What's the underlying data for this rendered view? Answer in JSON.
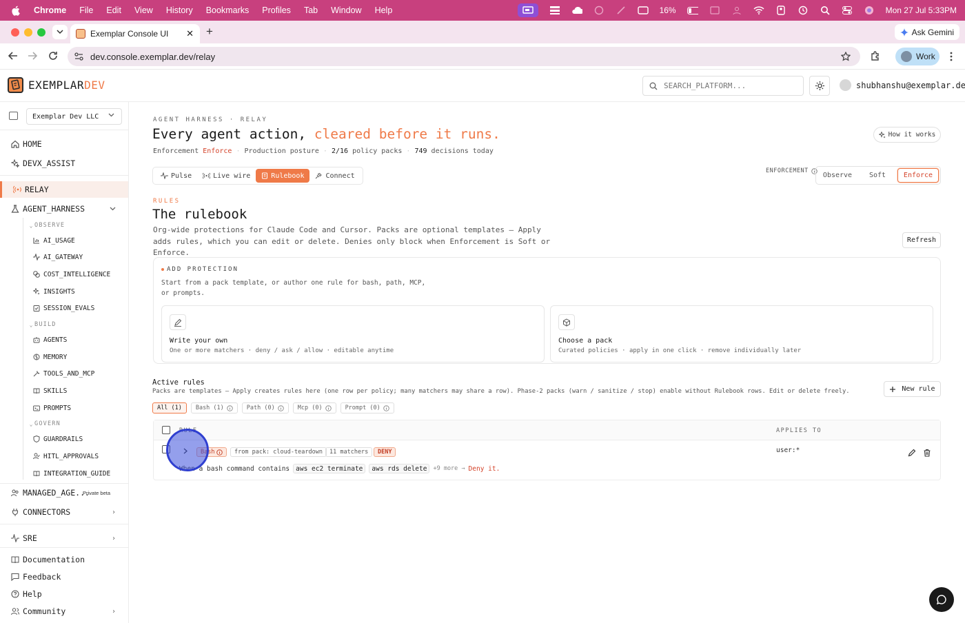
{
  "menubar": {
    "app": "Chrome",
    "items": [
      "File",
      "Edit",
      "View",
      "History",
      "Bookmarks",
      "Profiles",
      "Tab",
      "Window",
      "Help"
    ],
    "battery": "16%",
    "datetime": "Mon 27 Jul  5:33PM"
  },
  "browser": {
    "tab_title": "Exemplar Console UI",
    "url": "dev.console.exemplar.dev/relay",
    "ask_gemini": "Ask Gemini",
    "profile": "Work"
  },
  "app": {
    "brand_main": "EXEMPLAR",
    "brand_accent": "DEV",
    "search_placeholder": "SEARCH_PLATFORM...",
    "user_email": "shubhanshu@exemplar.dev"
  },
  "sidebar": {
    "org": "Exemplar Dev LLC",
    "home": "HOME",
    "devx_assist": "DEVX_ASSIST",
    "relay": "RELAY",
    "agent_harness": "AGENT_HARNESS",
    "group_observe": "OBSERVE",
    "ai_usage": "AI_USAGE",
    "ai_gateway": "AI_GATEWAY",
    "cost_intelligence": "COST_INTELLIGENCE",
    "insights": "INSIGHTS",
    "session_evals": "SESSION_EVALS",
    "group_build": "BUILD",
    "agents": "AGENTS",
    "memory": "MEMORY",
    "tools_and_mcp": "TOOLS_AND_MCP",
    "skills": "SKILLS",
    "prompts": "PROMPTS",
    "group_govern": "GOVERN",
    "guardrails": "GUARDRAILS",
    "hitl_approvals": "HITL_APPROVALS",
    "integration_guide": "INTEGRATION_GUIDE",
    "managed_agents": "MANAGED_AGE...",
    "private_beta": "Private beta",
    "connectors": "CONNECTORS",
    "sre": "SRE",
    "documentation": "Documentation",
    "feedback": "Feedback",
    "help": "Help",
    "community": "Community"
  },
  "page": {
    "eyebrow": "AGENT HARNESS · RELAY",
    "headline_main": "Every agent action,",
    "headline_accent": "cleared before it runs.",
    "meta_enforcement_label": "Enforcement",
    "meta_enforcement_value": "Enforce",
    "meta_posture": "Production posture",
    "meta_packs_value": "2/16",
    "meta_packs_label": "policy packs",
    "meta_decisions_value": "749",
    "meta_decisions_label": "decisions today",
    "how_it_works": "How it works",
    "tabs": {
      "pulse": "Pulse",
      "live_wire": "Live wire",
      "rulebook": "Rulebook",
      "connect": "Connect"
    },
    "enforcement_label": "ENFORCEMENT",
    "enforcement_options": {
      "observe": "Observe",
      "soft": "Soft",
      "enforce": "Enforce"
    }
  },
  "rulebook": {
    "eyebrow": "RULES",
    "title": "The rulebook",
    "description": "Org-wide protections for Claude Code and Cursor. Packs are optional templates — Apply adds rules, which you can edit or delete. Denies only block when Enforcement is Soft or Enforce.",
    "refresh": "Refresh",
    "add_protection": {
      "eyebrow": "ADD PROTECTION",
      "subtitle": "Start from a pack template, or author one rule for bash, path, MCP, or prompts.",
      "write_title": "Write your own",
      "write_desc": "One or more matchers · deny / ask / allow · editable anytime",
      "pack_title": "Choose a pack",
      "pack_desc": "Curated policies · apply in one click · remove individually later"
    },
    "active_rules": {
      "title": "Active rules",
      "description": "Packs are templates — Apply creates rules here (one row per policy; many matchers may share a row). Phase-2 packs (warn / sanitize / stop) enable without Rulebook rows. Edit or delete freely.",
      "new_rule": "New rule",
      "filters": {
        "all": "All (1)",
        "bash": "Bash (1)",
        "path": "Path (0)",
        "mcp": "Mcp (0)",
        "prompt": "Prompt (0)"
      },
      "col_rule": "RULE",
      "col_applies": "APPLIES TO",
      "row": {
        "type": "Bash",
        "pack": "from pack: cloud-teardown",
        "matchers": "11 matchers",
        "action": "DENY",
        "when_prefix": "When a bash command contains",
        "cmd1": "aws ec2 terminate",
        "cmd2": "aws rds delete",
        "more": "+9 more →",
        "result": "Deny it.",
        "applies_to": "user:*"
      }
    }
  },
  "colors": {
    "accent": "#ef7a48",
    "deny": "#d4432a",
    "menubar": "#c8407e"
  }
}
